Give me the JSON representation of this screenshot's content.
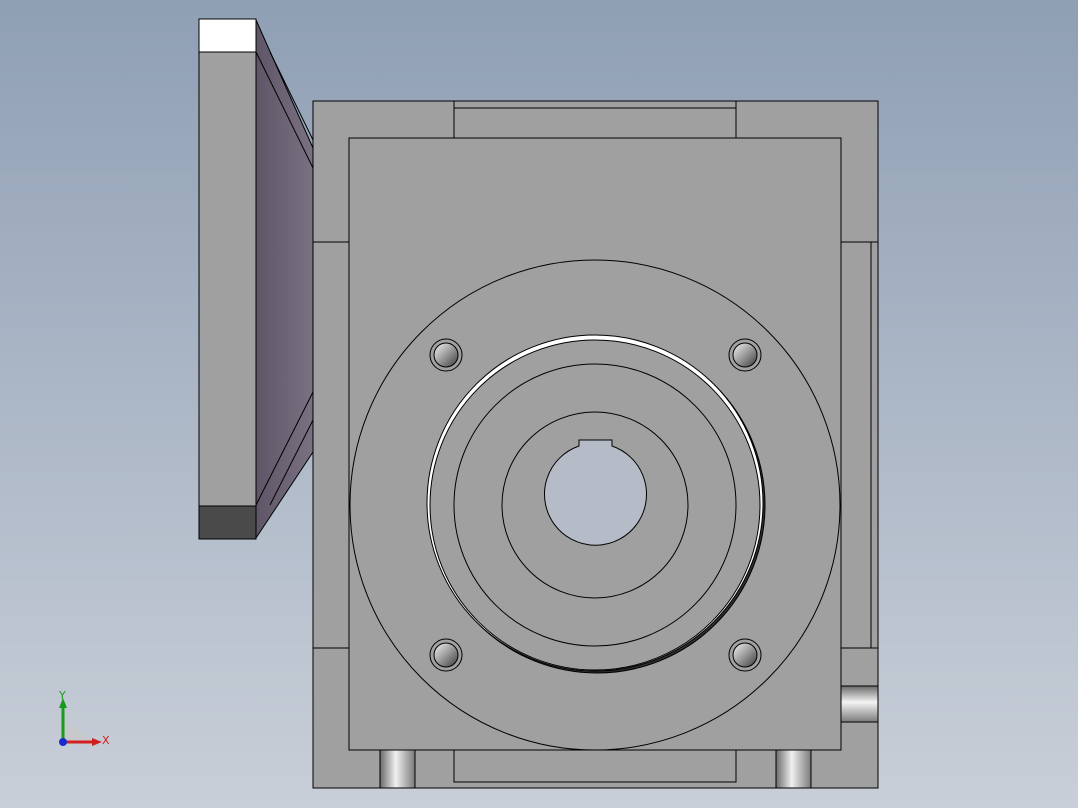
{
  "viewport": {
    "background_top": "#8f9fb4",
    "background_bottom": "#c9cfd8"
  },
  "model": {
    "body_color": "#a0a0a0",
    "edge_color": "#000000",
    "side_face_color": "#6e6676",
    "bore_color": "#b5bcc8"
  },
  "triad": {
    "x_label": "X",
    "y_label": "Y",
    "x_color": "#d02020",
    "y_color": "#1a9a1a",
    "z_color": "#1a2ad0"
  }
}
